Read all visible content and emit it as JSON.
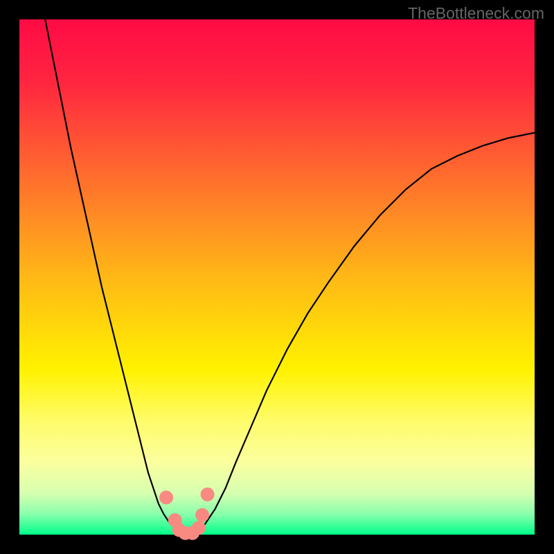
{
  "watermark": "TheBottleneck.com",
  "chart_data": {
    "type": "line",
    "title": "",
    "xlabel": "",
    "ylabel": "",
    "xlim": [
      0,
      100
    ],
    "ylim": [
      0,
      100
    ],
    "background": {
      "type": "vertical-gradient",
      "stops": [
        {
          "offset": 0.0,
          "color": "#ff0b45"
        },
        {
          "offset": 0.12,
          "color": "#ff2540"
        },
        {
          "offset": 0.3,
          "color": "#ff6b2e"
        },
        {
          "offset": 0.5,
          "color": "#ffb816"
        },
        {
          "offset": 0.68,
          "color": "#fff200"
        },
        {
          "offset": 0.78,
          "color": "#fffc6a"
        },
        {
          "offset": 0.86,
          "color": "#fbff9f"
        },
        {
          "offset": 0.92,
          "color": "#d6ffb0"
        },
        {
          "offset": 0.96,
          "color": "#8affac"
        },
        {
          "offset": 1.0,
          "color": "#00ff8a"
        }
      ]
    },
    "series": [
      {
        "name": "curve-left",
        "stroke": "#000000",
        "x": [
          5,
          6,
          7,
          8,
          10,
          12,
          14,
          16,
          18,
          20,
          22,
          24,
          25,
          26,
          27,
          28,
          29,
          30,
          31,
          32
        ],
        "y": [
          100,
          95,
          90,
          85,
          75,
          66,
          57,
          48,
          40,
          32,
          24,
          16,
          12,
          9,
          6,
          4,
          2.5,
          1.5,
          0.7,
          0.2
        ]
      },
      {
        "name": "curve-right",
        "stroke": "#000000",
        "x": [
          34,
          35,
          36,
          38,
          40,
          42,
          45,
          48,
          52,
          56,
          60,
          65,
          70,
          75,
          80,
          85,
          90,
          95,
          100
        ],
        "y": [
          0.2,
          0.9,
          2,
          5,
          9,
          14,
          21,
          28,
          36,
          43,
          49,
          56,
          62,
          67,
          71,
          73.5,
          75.5,
          77,
          78
        ]
      }
    ],
    "trough_markers": {
      "fill": "#f88a82",
      "points": [
        {
          "x": 28.5,
          "y": 7.2
        },
        {
          "x": 30.2,
          "y": 2.8
        },
        {
          "x": 31.0,
          "y": 0.9
        },
        {
          "x": 32.2,
          "y": 0.3
        },
        {
          "x": 33.6,
          "y": 0.3
        },
        {
          "x": 34.8,
          "y": 1.3
        },
        {
          "x": 35.5,
          "y": 3.8
        },
        {
          "x": 36.5,
          "y": 7.8
        }
      ],
      "radius": 10
    },
    "frame": {
      "color": "#000000",
      "thickness": 28
    }
  }
}
